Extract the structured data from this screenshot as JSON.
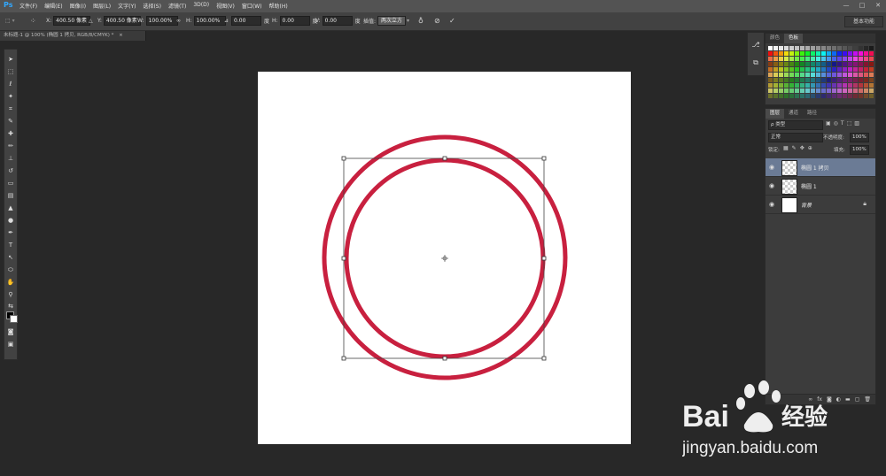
{
  "app": {
    "logo": "Ps",
    "menu": [
      "文件(F)",
      "编辑(E)",
      "图像(I)",
      "图层(L)",
      "文字(Y)",
      "选择(S)",
      "滤镜(T)",
      "3D(D)",
      "视图(V)",
      "窗口(W)",
      "帮助(H)"
    ],
    "window_controls": [
      "—",
      "□",
      "✕"
    ]
  },
  "options_bar": {
    "x_label": "X:",
    "x_value": "400.50 像素",
    "y_label": "Y:",
    "y_value": "400.50 像素",
    "w_label": "W:",
    "w_value": "100.00%",
    "h_label": "H:",
    "h_value": "100.00%",
    "rotate_value": "0.00",
    "rotate_unit": "度",
    "hskew_label": "H:",
    "hskew_value": "0.00",
    "hskew_unit": "度",
    "vskew_label": "V:",
    "vskew_value": "0.00",
    "vskew_unit": "度",
    "interp_label": "插值:",
    "interp_value": "两次立方",
    "workspace": "基本功能"
  },
  "document": {
    "tab_title": "未标题-1 @ 100% (椭圆 1 拷贝, RGB/8/CMYK) *",
    "tab_close": "×"
  },
  "panels": {
    "swatches_tabs": [
      "颜色",
      "色板"
    ],
    "layers_tabs": [
      "图层",
      "通道",
      "路径"
    ],
    "kind_filter": "ρ 类型",
    "blend_mode": "正常",
    "opacity_label": "不透明度:",
    "opacity_value": "100%",
    "lock_label": "锁定:",
    "fill_label": "填充:",
    "fill_value": "100%",
    "layers": [
      {
        "name": "椭圆 1 拷贝",
        "selected": true
      },
      {
        "name": "椭圆 1",
        "selected": false
      },
      {
        "name": "背景",
        "selected": false
      }
    ]
  },
  "colors": {
    "circle_stroke": "#c8203f",
    "selected_layer": "#6b7b95",
    "accent": "#31a8ff"
  },
  "watermark": {
    "brand": "Bai",
    "brand_cn": "经验",
    "url": "jingyan.baidu.com"
  }
}
